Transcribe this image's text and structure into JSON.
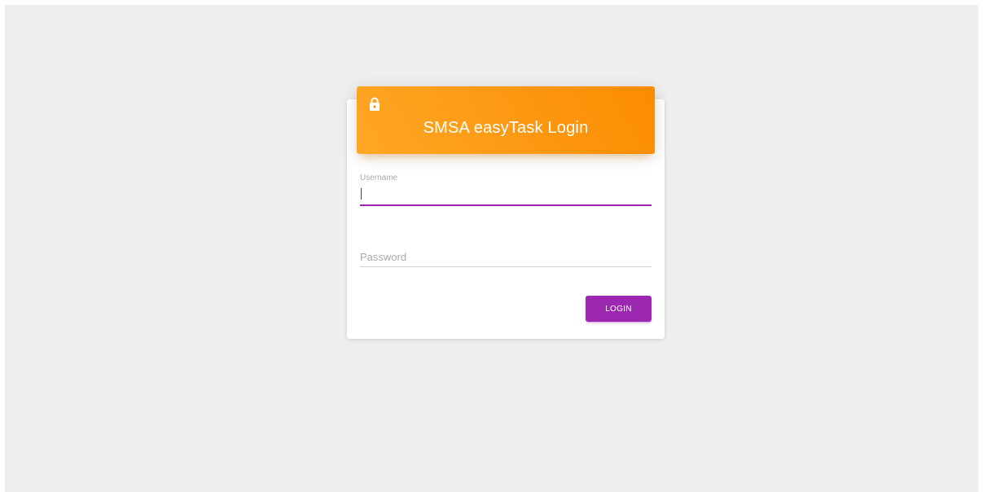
{
  "login": {
    "title": "SMSA easyTask Login",
    "header_icon": "lock-icon",
    "username": {
      "label": "Username",
      "value": ""
    },
    "password": {
      "label": "Password",
      "value": ""
    },
    "submit_label": "LOGIN"
  },
  "colors": {
    "background": "#eeeeee",
    "header_gradient_start": "#ffa726",
    "header_gradient_end": "#fb8c00",
    "accent": "#9c27b0"
  }
}
